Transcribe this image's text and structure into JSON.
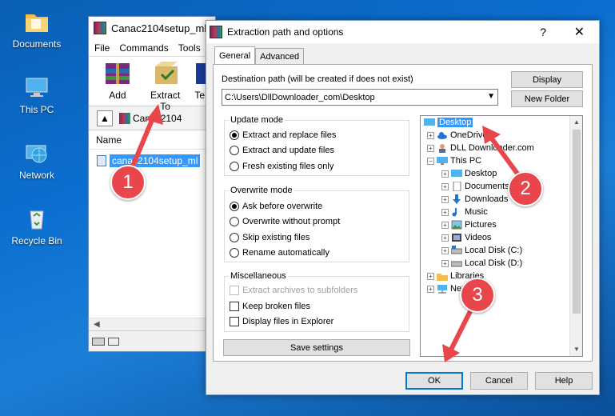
{
  "desktop": {
    "icons": [
      {
        "label": "Documents",
        "icon": "folder-icon"
      },
      {
        "label": "This PC",
        "icon": "computer-icon"
      },
      {
        "label": "Network",
        "icon": "network-globe-icon"
      },
      {
        "label": "Recycle Bin",
        "icon": "recycle-bin-icon"
      }
    ]
  },
  "winrar": {
    "title": "Canac2104setup_ml",
    "menu": [
      "File",
      "Commands",
      "Tools"
    ],
    "toolbar": [
      {
        "label": "Add",
        "icon": "add-archive-icon"
      },
      {
        "label": "Extract To",
        "icon": "extract-to-icon"
      },
      {
        "label": "Te",
        "icon": "test-icon"
      }
    ],
    "address": "Canac2104",
    "column_name": "Name",
    "file": "canac2104setup_ml"
  },
  "dialog": {
    "title": "Extraction path and options",
    "help": "?",
    "close": "✕",
    "tabs": [
      "General",
      "Advanced"
    ],
    "dest_label": "Destination path (will be created if does not exist)",
    "dest_value": "C:\\Users\\DllDownloader_com\\Desktop",
    "btn_display": "Display",
    "btn_new_folder": "New Folder",
    "update_mode": {
      "title": "Update mode",
      "options": [
        "Extract and replace files",
        "Extract and update files",
        "Fresh existing files only"
      ],
      "selected": 0
    },
    "overwrite_mode": {
      "title": "Overwrite mode",
      "options": [
        "Ask before overwrite",
        "Overwrite without prompt",
        "Skip existing files",
        "Rename automatically"
      ],
      "selected": 0
    },
    "misc": {
      "title": "Miscellaneous",
      "options": [
        "Extract archives to subfolders",
        "Keep broken files",
        "Display files in Explorer"
      ]
    },
    "btn_save": "Save settings",
    "tree": [
      {
        "label": "Desktop",
        "icon": "desktop-icon",
        "selected": true
      },
      {
        "label": "OneDrive",
        "icon": "onedrive-cloud-icon"
      },
      {
        "label": "DLL Downloader.com",
        "icon": "user-icon"
      },
      {
        "label": "This PC",
        "icon": "computer-icon"
      },
      {
        "label": "Desktop",
        "icon": "desktop-icon"
      },
      {
        "label": "Documents",
        "icon": "document-icon"
      },
      {
        "label": "Downloads",
        "icon": "download-arrow-icon"
      },
      {
        "label": "Music",
        "icon": "music-icon"
      },
      {
        "label": "Pictures",
        "icon": "pictures-icon"
      },
      {
        "label": "Videos",
        "icon": "videos-icon"
      },
      {
        "label": "Local Disk (C:)",
        "icon": "drive-icon"
      },
      {
        "label": "Local Disk (D:)",
        "icon": "drive-icon"
      },
      {
        "label": "Libraries",
        "icon": "libraries-icon"
      },
      {
        "label": "Network",
        "icon": "network-icon"
      }
    ],
    "btn_ok": "OK",
    "btn_cancel": "Cancel",
    "btn_help": "Help"
  },
  "annotations": [
    "1",
    "2",
    "3"
  ],
  "colors": {
    "badge": "#e8464b",
    "selection": "#3399ff",
    "desktop_bg": "#0b6fd0"
  }
}
